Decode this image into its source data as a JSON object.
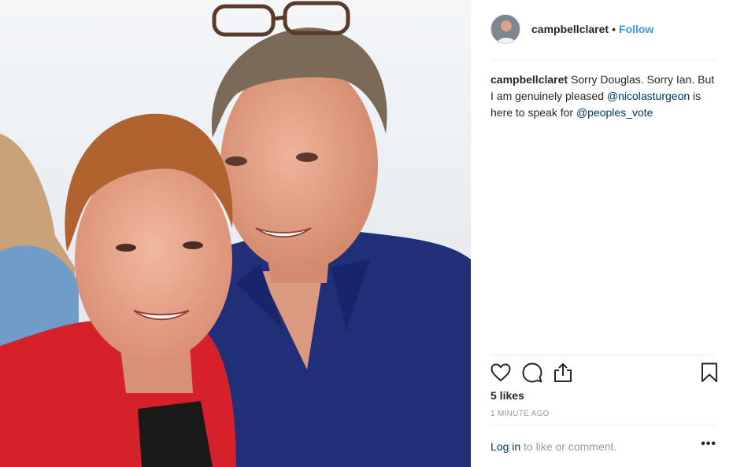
{
  "post": {
    "image_alt": "Selfie of a woman in a red jacket and a man in a navy shirt with glasses on his head",
    "header": {
      "username": "campbellclaret",
      "separator": "•",
      "follow_label": "Follow"
    },
    "caption": {
      "username": "campbellclaret",
      "text_before": "Sorry Douglas. Sorry Ian. But I am genuinely pleased ",
      "mention_1": "@nicolasturgeon",
      "text_middle": " is here to speak for ",
      "mention_2": "@peoples_vote"
    },
    "actions": {
      "like_icon": "heart-icon",
      "comment_icon": "comment-bubble-icon",
      "share_icon": "share-upload-icon",
      "save_icon": "bookmark-icon"
    },
    "likes_text": "5 likes",
    "timestamp": "1 MINUTE AGO",
    "login": {
      "link_label": "Log in",
      "rest_text": " to like or comment.",
      "more_label": "•••"
    }
  }
}
